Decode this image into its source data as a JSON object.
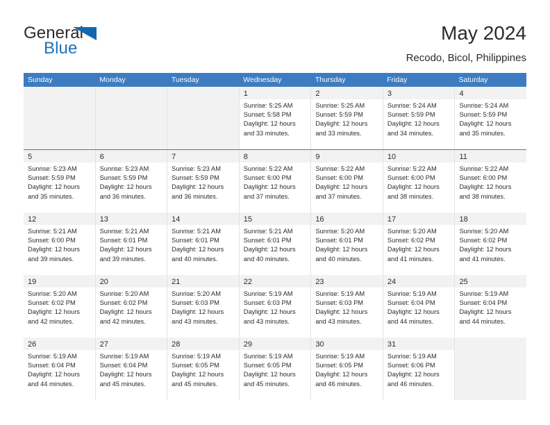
{
  "brand": {
    "name_part1": "General",
    "name_part2": "Blue",
    "logo_icon": "triangle-logo-icon"
  },
  "header": {
    "title": "May 2024",
    "subtitle": "Recodo, Bicol, Philippines"
  },
  "calendar": {
    "weekdays": [
      "Sunday",
      "Monday",
      "Tuesday",
      "Wednesday",
      "Thursday",
      "Friday",
      "Saturday"
    ],
    "accent_color": "#3d7cc0",
    "day_header_bg": "#f2f2f2",
    "empty_cell_bg": "#f2f2f2",
    "weeks": [
      [
        {
          "empty": true
        },
        {
          "empty": true
        },
        {
          "empty": true
        },
        {
          "day": "1",
          "sunrise": "Sunrise: 5:25 AM",
          "sunset": "Sunset: 5:58 PM",
          "daylight1": "Daylight: 12 hours",
          "daylight2": "and 33 minutes."
        },
        {
          "day": "2",
          "sunrise": "Sunrise: 5:25 AM",
          "sunset": "Sunset: 5:59 PM",
          "daylight1": "Daylight: 12 hours",
          "daylight2": "and 33 minutes."
        },
        {
          "day": "3",
          "sunrise": "Sunrise: 5:24 AM",
          "sunset": "Sunset: 5:59 PM",
          "daylight1": "Daylight: 12 hours",
          "daylight2": "and 34 minutes."
        },
        {
          "day": "4",
          "sunrise": "Sunrise: 5:24 AM",
          "sunset": "Sunset: 5:59 PM",
          "daylight1": "Daylight: 12 hours",
          "daylight2": "and 35 minutes."
        }
      ],
      [
        {
          "day": "5",
          "sunrise": "Sunrise: 5:23 AM",
          "sunset": "Sunset: 5:59 PM",
          "daylight1": "Daylight: 12 hours",
          "daylight2": "and 35 minutes."
        },
        {
          "day": "6",
          "sunrise": "Sunrise: 5:23 AM",
          "sunset": "Sunset: 5:59 PM",
          "daylight1": "Daylight: 12 hours",
          "daylight2": "and 36 minutes."
        },
        {
          "day": "7",
          "sunrise": "Sunrise: 5:23 AM",
          "sunset": "Sunset: 5:59 PM",
          "daylight1": "Daylight: 12 hours",
          "daylight2": "and 36 minutes."
        },
        {
          "day": "8",
          "sunrise": "Sunrise: 5:22 AM",
          "sunset": "Sunset: 6:00 PM",
          "daylight1": "Daylight: 12 hours",
          "daylight2": "and 37 minutes."
        },
        {
          "day": "9",
          "sunrise": "Sunrise: 5:22 AM",
          "sunset": "Sunset: 6:00 PM",
          "daylight1": "Daylight: 12 hours",
          "daylight2": "and 37 minutes."
        },
        {
          "day": "10",
          "sunrise": "Sunrise: 5:22 AM",
          "sunset": "Sunset: 6:00 PM",
          "daylight1": "Daylight: 12 hours",
          "daylight2": "and 38 minutes."
        },
        {
          "day": "11",
          "sunrise": "Sunrise: 5:22 AM",
          "sunset": "Sunset: 6:00 PM",
          "daylight1": "Daylight: 12 hours",
          "daylight2": "and 38 minutes."
        }
      ],
      [
        {
          "day": "12",
          "sunrise": "Sunrise: 5:21 AM",
          "sunset": "Sunset: 6:00 PM",
          "daylight1": "Daylight: 12 hours",
          "daylight2": "and 39 minutes."
        },
        {
          "day": "13",
          "sunrise": "Sunrise: 5:21 AM",
          "sunset": "Sunset: 6:01 PM",
          "daylight1": "Daylight: 12 hours",
          "daylight2": "and 39 minutes."
        },
        {
          "day": "14",
          "sunrise": "Sunrise: 5:21 AM",
          "sunset": "Sunset: 6:01 PM",
          "daylight1": "Daylight: 12 hours",
          "daylight2": "and 40 minutes."
        },
        {
          "day": "15",
          "sunrise": "Sunrise: 5:21 AM",
          "sunset": "Sunset: 6:01 PM",
          "daylight1": "Daylight: 12 hours",
          "daylight2": "and 40 minutes."
        },
        {
          "day": "16",
          "sunrise": "Sunrise: 5:20 AM",
          "sunset": "Sunset: 6:01 PM",
          "daylight1": "Daylight: 12 hours",
          "daylight2": "and 40 minutes."
        },
        {
          "day": "17",
          "sunrise": "Sunrise: 5:20 AM",
          "sunset": "Sunset: 6:02 PM",
          "daylight1": "Daylight: 12 hours",
          "daylight2": "and 41 minutes."
        },
        {
          "day": "18",
          "sunrise": "Sunrise: 5:20 AM",
          "sunset": "Sunset: 6:02 PM",
          "daylight1": "Daylight: 12 hours",
          "daylight2": "and 41 minutes."
        }
      ],
      [
        {
          "day": "19",
          "sunrise": "Sunrise: 5:20 AM",
          "sunset": "Sunset: 6:02 PM",
          "daylight1": "Daylight: 12 hours",
          "daylight2": "and 42 minutes."
        },
        {
          "day": "20",
          "sunrise": "Sunrise: 5:20 AM",
          "sunset": "Sunset: 6:02 PM",
          "daylight1": "Daylight: 12 hours",
          "daylight2": "and 42 minutes."
        },
        {
          "day": "21",
          "sunrise": "Sunrise: 5:20 AM",
          "sunset": "Sunset: 6:03 PM",
          "daylight1": "Daylight: 12 hours",
          "daylight2": "and 43 minutes."
        },
        {
          "day": "22",
          "sunrise": "Sunrise: 5:19 AM",
          "sunset": "Sunset: 6:03 PM",
          "daylight1": "Daylight: 12 hours",
          "daylight2": "and 43 minutes."
        },
        {
          "day": "23",
          "sunrise": "Sunrise: 5:19 AM",
          "sunset": "Sunset: 6:03 PM",
          "daylight1": "Daylight: 12 hours",
          "daylight2": "and 43 minutes."
        },
        {
          "day": "24",
          "sunrise": "Sunrise: 5:19 AM",
          "sunset": "Sunset: 6:04 PM",
          "daylight1": "Daylight: 12 hours",
          "daylight2": "and 44 minutes."
        },
        {
          "day": "25",
          "sunrise": "Sunrise: 5:19 AM",
          "sunset": "Sunset: 6:04 PM",
          "daylight1": "Daylight: 12 hours",
          "daylight2": "and 44 minutes."
        }
      ],
      [
        {
          "day": "26",
          "sunrise": "Sunrise: 5:19 AM",
          "sunset": "Sunset: 6:04 PM",
          "daylight1": "Daylight: 12 hours",
          "daylight2": "and 44 minutes."
        },
        {
          "day": "27",
          "sunrise": "Sunrise: 5:19 AM",
          "sunset": "Sunset: 6:04 PM",
          "daylight1": "Daylight: 12 hours",
          "daylight2": "and 45 minutes."
        },
        {
          "day": "28",
          "sunrise": "Sunrise: 5:19 AM",
          "sunset": "Sunset: 6:05 PM",
          "daylight1": "Daylight: 12 hours",
          "daylight2": "and 45 minutes."
        },
        {
          "day": "29",
          "sunrise": "Sunrise: 5:19 AM",
          "sunset": "Sunset: 6:05 PM",
          "daylight1": "Daylight: 12 hours",
          "daylight2": "and 45 minutes."
        },
        {
          "day": "30",
          "sunrise": "Sunrise: 5:19 AM",
          "sunset": "Sunset: 6:05 PM",
          "daylight1": "Daylight: 12 hours",
          "daylight2": "and 46 minutes."
        },
        {
          "day": "31",
          "sunrise": "Sunrise: 5:19 AM",
          "sunset": "Sunset: 6:06 PM",
          "daylight1": "Daylight: 12 hours",
          "daylight2": "and 46 minutes."
        },
        {
          "empty": true
        }
      ]
    ]
  }
}
